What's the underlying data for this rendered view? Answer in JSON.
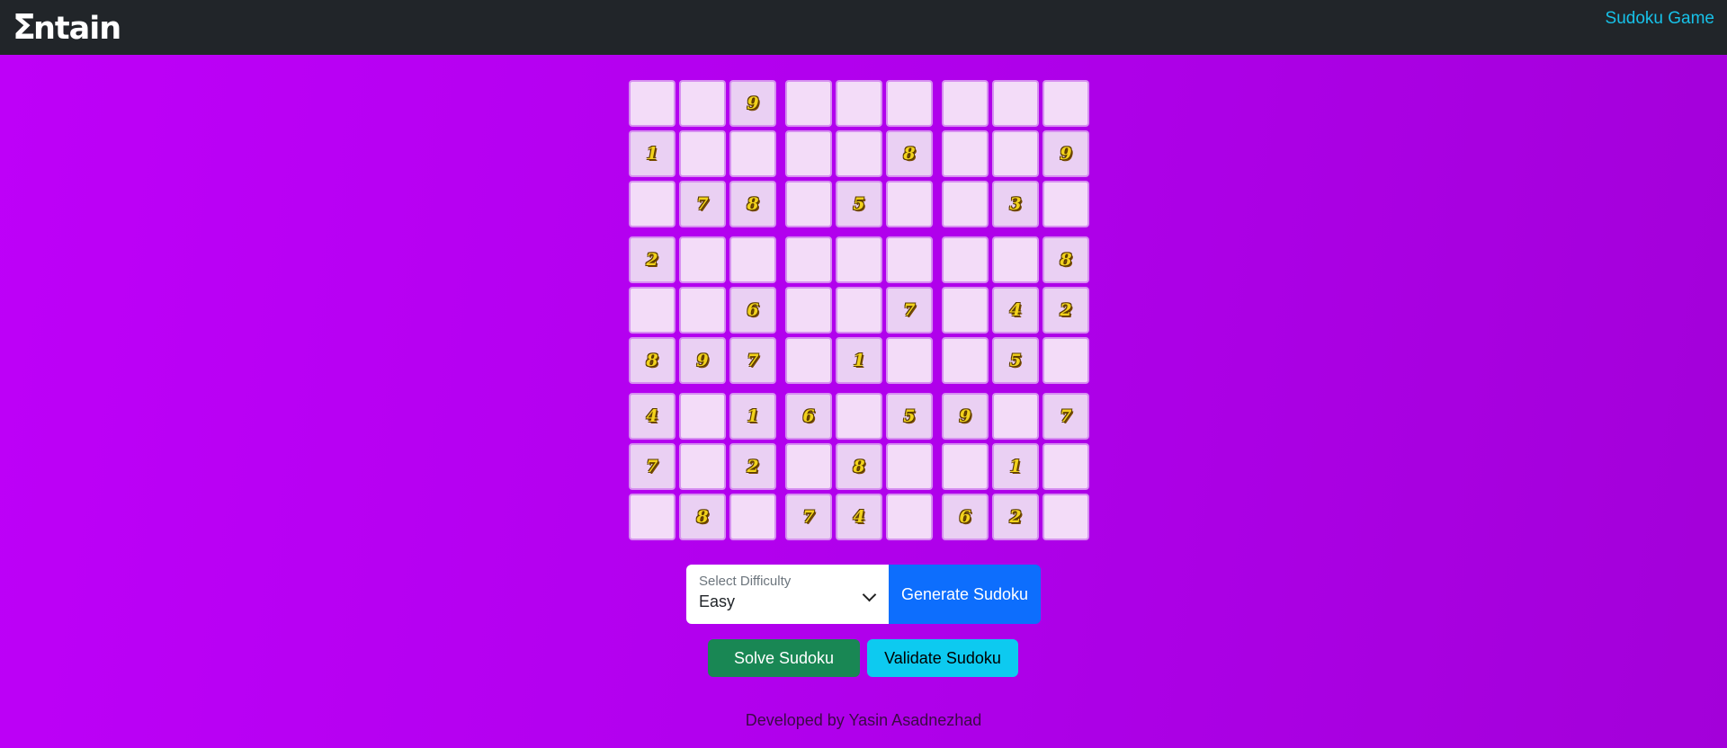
{
  "navbar": {
    "brand_sigma": "Σ",
    "brand_text": "ntain",
    "link_label": "Sudoku Game",
    "link_color": "#17c1e8",
    "background": "#212529"
  },
  "board": {
    "grid": [
      [
        0,
        0,
        9,
        0,
        0,
        0,
        0,
        0,
        0
      ],
      [
        1,
        0,
        0,
        0,
        0,
        8,
        0,
        0,
        9
      ],
      [
        0,
        7,
        8,
        0,
        5,
        0,
        0,
        3,
        0
      ],
      [
        2,
        0,
        0,
        0,
        0,
        0,
        0,
        0,
        8
      ],
      [
        0,
        0,
        6,
        0,
        0,
        7,
        0,
        4,
        2
      ],
      [
        8,
        9,
        7,
        0,
        1,
        0,
        0,
        5,
        0
      ],
      [
        4,
        0,
        1,
        6,
        0,
        5,
        9,
        0,
        7
      ],
      [
        7,
        0,
        2,
        0,
        8,
        0,
        0,
        1,
        0
      ],
      [
        0,
        8,
        0,
        7,
        4,
        0,
        6,
        2,
        0
      ]
    ],
    "digit_color": "#f2d21c"
  },
  "controls": {
    "difficulty_label": "Select Difficulty",
    "difficulty_value": "Easy",
    "generate_label": "Generate Sudoku",
    "solve_label": "Solve Sudoku",
    "validate_label": "Validate Sudoku"
  },
  "footer": {
    "text": "Developed by Yasin Asadnezhad"
  },
  "colors": {
    "background_start": "#be00f8",
    "background_end": "#a300d9",
    "generate": "#0d6efd",
    "solve": "#198754",
    "validate": "#0dcaf0"
  }
}
